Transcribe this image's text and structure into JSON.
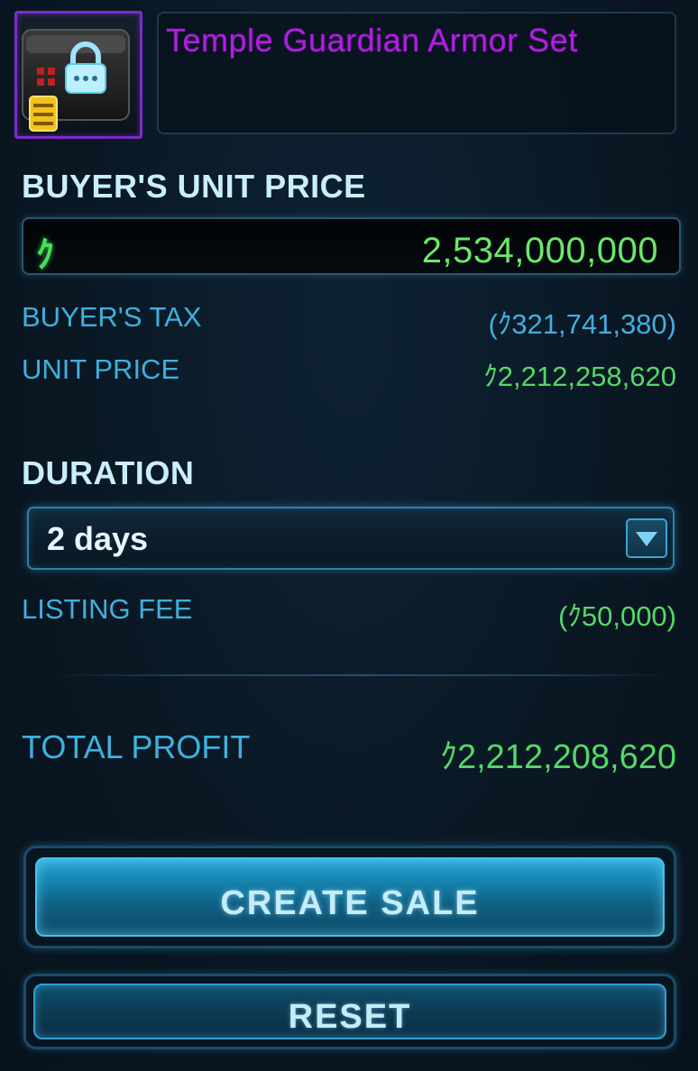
{
  "item": {
    "name": "Temple Guardian Armor Set",
    "icon": "locked-chest-icon",
    "rarity_color": "#b01fe0"
  },
  "buyer_unit_price": {
    "heading": "BUYER'S UNIT PRICE",
    "currency_symbol": "ｸ",
    "value": "2,534,000,000"
  },
  "summary": {
    "buyers_tax_label": "BUYER'S TAX",
    "buyers_tax_value": "(ｸ321,741,380)",
    "unit_price_label": "UNIT PRICE",
    "unit_price_value": "ｸ2,212,258,620"
  },
  "duration": {
    "heading": "DURATION",
    "selected": "2 days",
    "listing_fee_label": "LISTING FEE",
    "listing_fee_value": "(ｸ50,000)"
  },
  "total": {
    "label": "TOTAL PROFIT",
    "value": "ｸ2,212,208,620"
  },
  "buttons": {
    "create_sale": "CREATE SALE",
    "reset": "RESET"
  },
  "colors": {
    "accent_blue": "#3fb0de",
    "value_green": "#55d868",
    "item_purple": "#b01fe0"
  }
}
